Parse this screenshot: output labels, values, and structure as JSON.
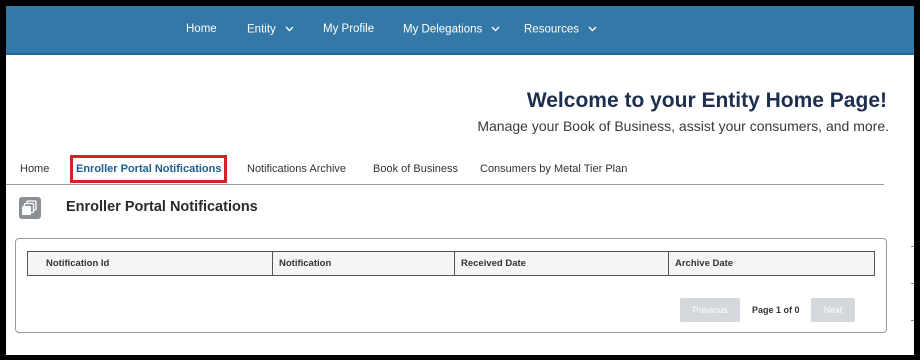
{
  "nav": {
    "home": "Home",
    "entity": "Entity",
    "my_profile": "My Profile",
    "my_delegations": "My Delegations",
    "resources": "Resources"
  },
  "welcome": {
    "title": "Welcome to your Entity Home Page!",
    "subtitle": "Manage your Book of Business, assist your consumers, and more."
  },
  "tabs": [
    {
      "label": "Home"
    },
    {
      "label": "Enroller Portal Notifications"
    },
    {
      "label": "Notifications Archive"
    },
    {
      "label": "Book of Business"
    },
    {
      "label": "Consumers by Metal Tier Plan"
    }
  ],
  "section": {
    "title": "Enroller Portal Notifications",
    "icon": "notifications-stack-icon"
  },
  "table": {
    "columns": [
      "Notification Id",
      "Notification",
      "Received Date",
      "Archive Date"
    ]
  },
  "pager": {
    "previous": "Previous",
    "page_label": "Page 1 of 0",
    "next": "Next"
  },
  "colors": {
    "nav_bg": "#3478a8",
    "active_tab_text": "#1b5f8f",
    "highlight_border": "#d61f26",
    "title_color": "#1d2f4d"
  }
}
